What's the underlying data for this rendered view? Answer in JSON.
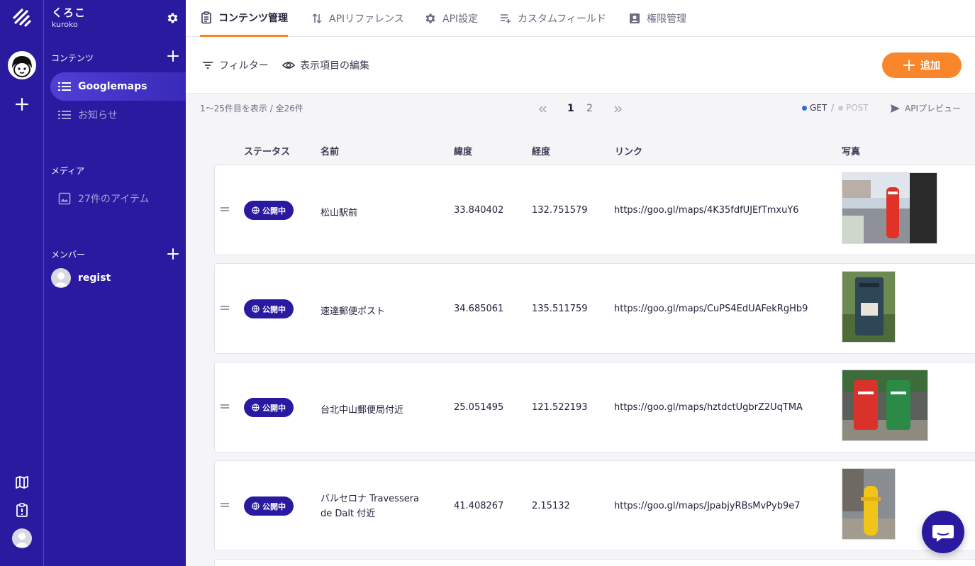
{
  "service": {
    "name": "くろこ",
    "id": "kuroko"
  },
  "sidebar": {
    "contents_label": "コンテンツ",
    "items": [
      {
        "label": "Googlemaps",
        "active": true
      },
      {
        "label": "お知らせ",
        "active": false
      }
    ],
    "media_label": "メディア",
    "media_item": "27件のアイテム",
    "members_label": "メンバー",
    "member": "regist"
  },
  "tabs": [
    {
      "label": "コンテンツ管理",
      "icon": "clipboard-icon",
      "active": true
    },
    {
      "label": "APIリファレンス",
      "icon": "sort-arrows-icon",
      "active": false
    },
    {
      "label": "API設定",
      "icon": "gear-icon",
      "active": false
    },
    {
      "label": "カスタムフィールド",
      "icon": "playlist-add-icon",
      "active": false
    },
    {
      "label": "権限管理",
      "icon": "account-box-icon",
      "active": false
    }
  ],
  "toolbar": {
    "filter_label": "フィルター",
    "columns_label": "表示項目の編集",
    "add_label": "追加"
  },
  "list": {
    "range_text": "1〜25件目を表示 / 全26件",
    "pages": [
      "1",
      "2"
    ],
    "current_page": "1",
    "method_get": "GET",
    "method_sep": "/",
    "method_post": "POST",
    "preview_label": "APIプレビュー"
  },
  "columns": {
    "status": "ステータス",
    "name": "名前",
    "lat": "緯度",
    "lng": "経度",
    "link": "リンク",
    "photo": "写真"
  },
  "rows": [
    {
      "status": "公開中",
      "name": "松山駅前",
      "lat": "33.840402",
      "lng": "132.751579",
      "link": "https://goo.gl/maps/4K35fdfUJEfTmxuY6"
    },
    {
      "status": "公開中",
      "name": "速達郵便ポスト",
      "lat": "34.685061",
      "lng": "135.511759",
      "link": "https://goo.gl/maps/CuPS4EdUAFekRgHb9"
    },
    {
      "status": "公開中",
      "name": "台北中山郵便局付近",
      "lat": "25.051495",
      "lng": "121.522193",
      "link": "https://goo.gl/maps/hztdctUgbrZ2UqTMA"
    },
    {
      "status": "公開中",
      "name_line1": "バルセロナ Travessera",
      "name_line2": "de Dalt 付近",
      "lat": "41.408267",
      "lng": "2.15132",
      "link": "https://goo.gl/maps/JpabjyRBsMvPyb9e7"
    }
  ],
  "colors": {
    "brand": "#2a1aa0",
    "accent": "#f9862a",
    "get_dot": "#2a6fdb",
    "post_dot": "#cccccc"
  }
}
